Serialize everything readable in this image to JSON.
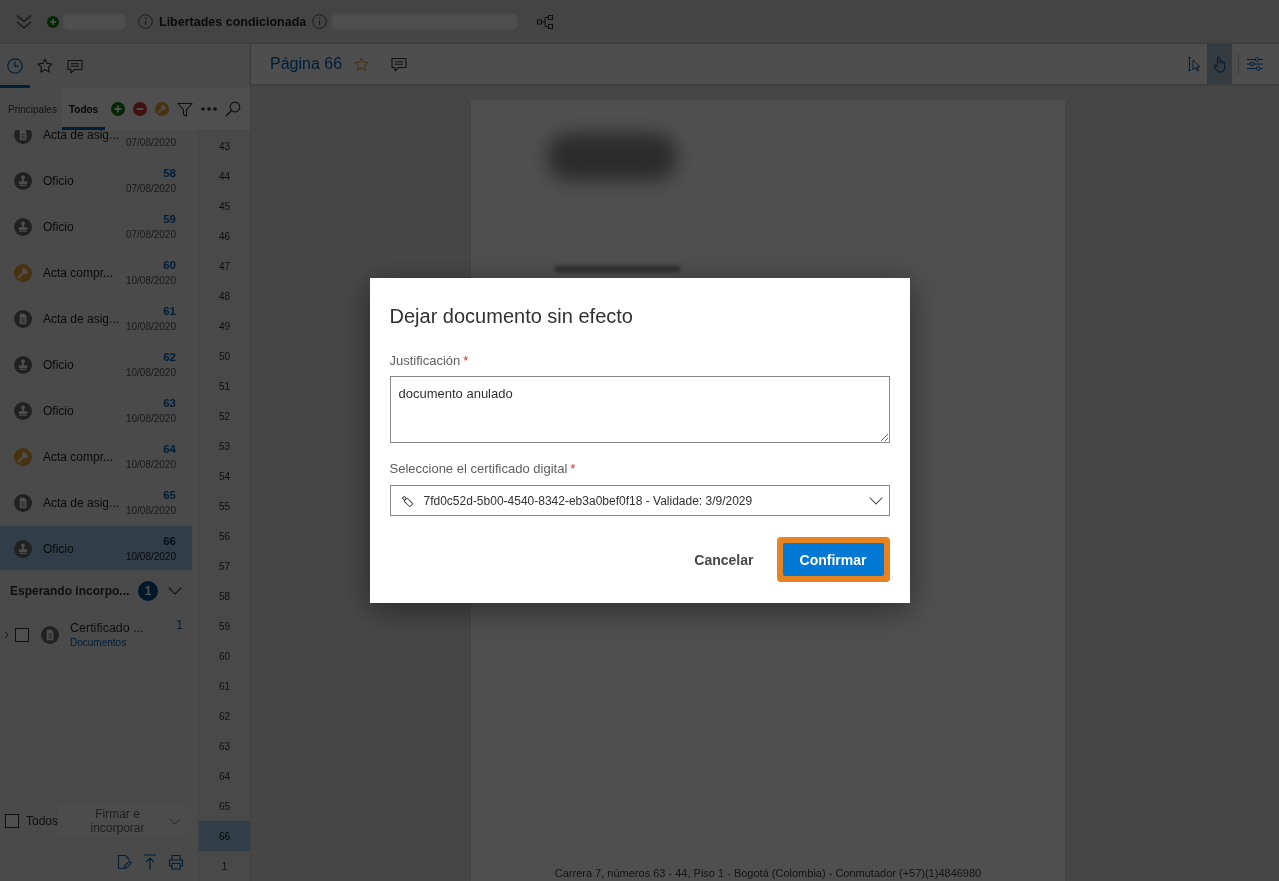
{
  "top_bar": {
    "title": "Libertades condicionada"
  },
  "sidebar": {
    "tabs": [
      {
        "kind": "history",
        "selected": true
      },
      {
        "kind": "favorites",
        "selected": false
      },
      {
        "kind": "comments",
        "selected": false
      }
    ],
    "filters": [
      {
        "label": "Principales",
        "selected": false
      },
      {
        "label": "Todos",
        "selected": true
      }
    ],
    "documents": [
      {
        "kind": "document",
        "name": "Acta de asig...",
        "date": "07/08/2020",
        "selected": false
      },
      {
        "kind": "stamp",
        "name": "Oficio",
        "number": "58",
        "date": "07/08/2020",
        "selected": false
      },
      {
        "kind": "stamp",
        "name": "Oficio",
        "number": "59",
        "date": "07/08/2020",
        "selected": false
      },
      {
        "kind": "gavel",
        "name": "Acta compr...",
        "number": "60",
        "date": "10/08/2020",
        "selected": false
      },
      {
        "kind": "document",
        "name": "Acta de asig...",
        "number": "61",
        "date": "10/08/2020",
        "selected": false
      },
      {
        "kind": "stamp",
        "name": "Oficio",
        "number": "62",
        "date": "10/08/2020",
        "selected": false
      },
      {
        "kind": "stamp",
        "name": "Oficio",
        "number": "63",
        "date": "10/08/2020",
        "selected": false
      },
      {
        "kind": "gavel",
        "name": "Acta compr...",
        "number": "64",
        "date": "10/08/2020",
        "selected": false
      },
      {
        "kind": "document",
        "name": "Acta de asig...",
        "number": "65",
        "date": "10/08/2020",
        "selected": false
      },
      {
        "kind": "stamp",
        "name": "Oficio",
        "number": "66",
        "date": "10/08/2020",
        "selected": true
      }
    ],
    "pending": {
      "title": "Esperando incorpo...",
      "count": "1",
      "expanded": true,
      "items": [
        {
          "kind": "document",
          "name": "Certificado ...",
          "category": "Documentos",
          "number": "1",
          "checked": false,
          "expanded": false
        }
      ]
    },
    "select_all": {
      "label": "Todos",
      "checked": false
    },
    "sign_button": {
      "label": "Firmar e incorporar",
      "disabled": true
    },
    "page_numbers": [
      {
        "label": "43",
        "selected": false
      },
      {
        "label": "44",
        "selected": false
      },
      {
        "label": "45",
        "selected": false
      },
      {
        "label": "46",
        "selected": false
      },
      {
        "label": "47",
        "selected": false
      },
      {
        "label": "48",
        "selected": false
      },
      {
        "label": "49",
        "selected": false
      },
      {
        "label": "50",
        "selected": false
      },
      {
        "label": "51",
        "selected": false
      },
      {
        "label": "52",
        "selected": false
      },
      {
        "label": "53",
        "selected": false
      },
      {
        "label": "54",
        "selected": false
      },
      {
        "label": "55",
        "selected": false
      },
      {
        "label": "56",
        "selected": false
      },
      {
        "label": "57",
        "selected": false
      },
      {
        "label": "58",
        "selected": false
      },
      {
        "label": "59",
        "selected": false
      },
      {
        "label": "60",
        "selected": false
      },
      {
        "label": "61",
        "selected": false
      },
      {
        "label": "62",
        "selected": false
      },
      {
        "label": "63",
        "selected": false
      },
      {
        "label": "64",
        "selected": false
      },
      {
        "label": "65",
        "selected": false
      },
      {
        "label": "66",
        "selected": true
      },
      {
        "label": "1",
        "selected": false
      }
    ]
  },
  "viewer": {
    "title": "Página 66",
    "favorite": false,
    "tools": [
      {
        "kind": "textselect",
        "selected": false
      },
      {
        "kind": "pan",
        "selected": true
      }
    ],
    "footer": "Carrera 7, números 63 - 44, Piso 1 - Bogotá (Colombia) - Conmutador (+57)(1)4846980"
  },
  "dialog": {
    "title": "Dejar documento sin efecto",
    "fields": [
      {
        "kind": "textarea",
        "label": "Justificación",
        "required_mark": "*",
        "value": "documento anulado"
      },
      {
        "kind": "select",
        "label": "Seleccione el certificado digital",
        "required_mark": "*",
        "value": "7fd0c52d-5b00-4540-8342-eb3a0bef0f18 - Validade: 3/9/2029"
      }
    ],
    "buttons": [
      {
        "kind": "secondary",
        "label": "Cancelar",
        "highlighted": false
      },
      {
        "kind": "primary",
        "label": "Confirmar",
        "highlighted": true
      }
    ]
  }
}
